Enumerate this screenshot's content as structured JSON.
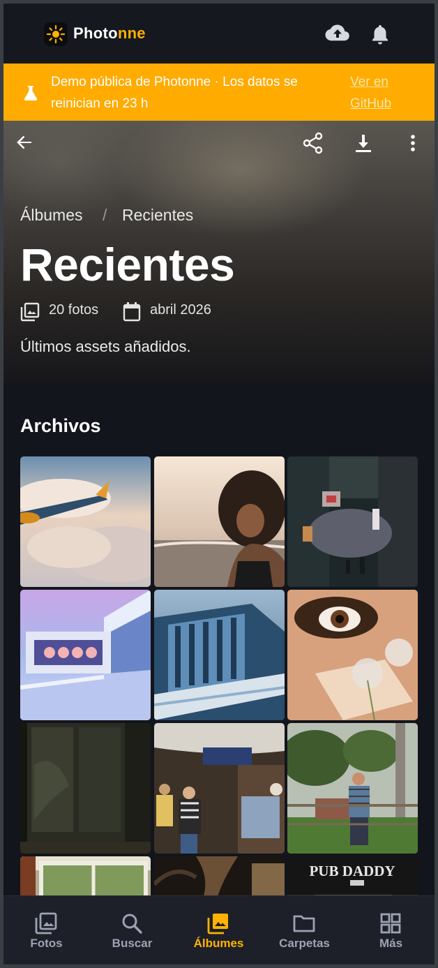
{
  "app": {
    "brand_prefix": "Photo",
    "brand_suffix": "nne",
    "icons": {
      "upload": "cloud-upload-icon",
      "notifications": "bell-icon"
    }
  },
  "banner": {
    "text": "Demo pública de Photonne · Los datos se reinician en 23 h",
    "link": "Ver en GitHub",
    "icon": "flask-icon",
    "color": "#ffab00"
  },
  "album": {
    "breadcrumb": [
      "Álbumes",
      "Recientes"
    ],
    "title": "Recientes",
    "count": "20 fotos",
    "date": "abril 2026",
    "description": "Últimos assets añadidos."
  },
  "section": {
    "title": "Archivos"
  },
  "photos": [
    "airplane-wing-over-clouds",
    "woman-on-beach-at-sunset",
    "night-street-shop",
    "pastel-building-pool",
    "blue-modern-building",
    "face-with-dandelion",
    "dark-window-plants",
    "street-market-shoppers",
    "man-by-fence-in-park",
    "window-with-plants",
    "dark-palm-leaves",
    "pub-sign"
  ],
  "nav": {
    "items": [
      {
        "label": "Fotos",
        "icon": "photos-icon"
      },
      {
        "label": "Buscar",
        "icon": "search-icon"
      },
      {
        "label": "Álbumes",
        "icon": "albums-icon"
      },
      {
        "label": "Carpetas",
        "icon": "folder-icon"
      },
      {
        "label": "Más",
        "icon": "grid-icon"
      }
    ],
    "active": "Álbumes",
    "accent": "#ffb300"
  }
}
